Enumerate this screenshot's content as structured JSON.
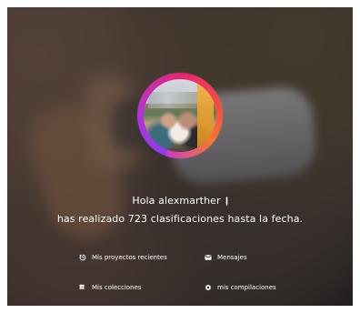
{
  "profile": {
    "greeting_text": "Hola alexmarther",
    "summary_text": "has realizado 723 clasificaciones hasta la fecha."
  },
  "menu": {
    "recent_projects": {
      "label": "Mis proyectos recientes",
      "icon": "history-icon"
    },
    "messages": {
      "label": "Mensajes",
      "icon": "mail-icon"
    },
    "collections": {
      "label": "Mis colecciones",
      "icon": "grid-icon"
    },
    "builds": {
      "label": "mis compilaciones",
      "icon": "gear-icon"
    }
  },
  "colors": {
    "text": "#ffffff",
    "ring_start": "#8e3bf0",
    "ring_mid": "#ea2472",
    "ring_end": "#f8782d"
  }
}
